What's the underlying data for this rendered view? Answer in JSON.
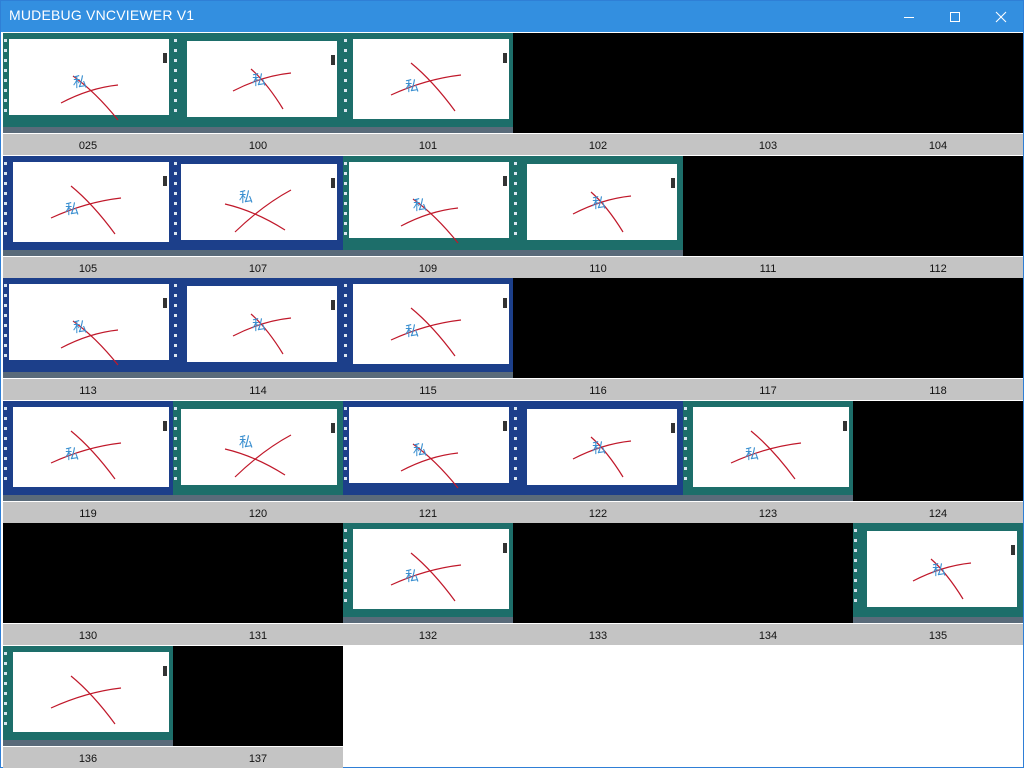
{
  "window": {
    "title": "MUDEBUG VNCVIEWER V1",
    "controls": {
      "minimize": "minimize-icon",
      "maximize": "maximize-icon",
      "close": "close-icon"
    }
  },
  "colors": {
    "titlebar": "#338fe0",
    "caption_bg": "#c4c4c4",
    "offline_screen": "#000000",
    "desktop_teal": "#1d6e6a",
    "desktop_blue": "#1c3f8a",
    "doc_white": "#ffffff",
    "cross_red": "#c0182a",
    "glyph_blue": "#3a8fd0"
  },
  "tiles": [
    {
      "label": "025",
      "state": "active",
      "desktop": "teal",
      "glyph": "私"
    },
    {
      "label": "100",
      "state": "active",
      "desktop": "teal",
      "glyph": "私"
    },
    {
      "label": "101",
      "state": "active",
      "desktop": "teal",
      "glyph": "私"
    },
    {
      "label": "102",
      "state": "offline"
    },
    {
      "label": "103",
      "state": "offline"
    },
    {
      "label": "104",
      "state": "offline"
    },
    {
      "label": "105",
      "state": "active",
      "desktop": "blue",
      "glyph": "私"
    },
    {
      "label": "107",
      "state": "active",
      "desktop": "blue",
      "glyph": "私"
    },
    {
      "label": "109",
      "state": "active",
      "desktop": "teal",
      "glyph": "私"
    },
    {
      "label": "110",
      "state": "active",
      "desktop": "teal",
      "glyph": "私"
    },
    {
      "label": "111",
      "state": "offline"
    },
    {
      "label": "112",
      "state": "offline"
    },
    {
      "label": "113",
      "state": "active",
      "desktop": "blue",
      "glyph": "私"
    },
    {
      "label": "114",
      "state": "active",
      "desktop": "blue",
      "glyph": "私"
    },
    {
      "label": "115",
      "state": "active",
      "desktop": "blue",
      "glyph": "私"
    },
    {
      "label": "116",
      "state": "offline"
    },
    {
      "label": "117",
      "state": "offline"
    },
    {
      "label": "118",
      "state": "offline"
    },
    {
      "label": "119",
      "state": "active",
      "desktop": "blue",
      "glyph": "私"
    },
    {
      "label": "120",
      "state": "active",
      "desktop": "teal",
      "glyph": "私"
    },
    {
      "label": "121",
      "state": "active",
      "desktop": "blue",
      "glyph": "私"
    },
    {
      "label": "122",
      "state": "active",
      "desktop": "blue",
      "glyph": "私"
    },
    {
      "label": "123",
      "state": "active",
      "desktop": "teal",
      "glyph": "私"
    },
    {
      "label": "124",
      "state": "offline"
    },
    {
      "label": "130",
      "state": "offline"
    },
    {
      "label": "131",
      "state": "offline"
    },
    {
      "label": "132",
      "state": "active",
      "desktop": "teal",
      "glyph": "私"
    },
    {
      "label": "133",
      "state": "offline"
    },
    {
      "label": "134",
      "state": "offline"
    },
    {
      "label": "135",
      "state": "active",
      "desktop": "teal",
      "glyph": "私"
    },
    {
      "label": "136",
      "state": "active",
      "desktop": "teal",
      "glyph": ""
    },
    {
      "label": "137",
      "state": "offline"
    }
  ]
}
